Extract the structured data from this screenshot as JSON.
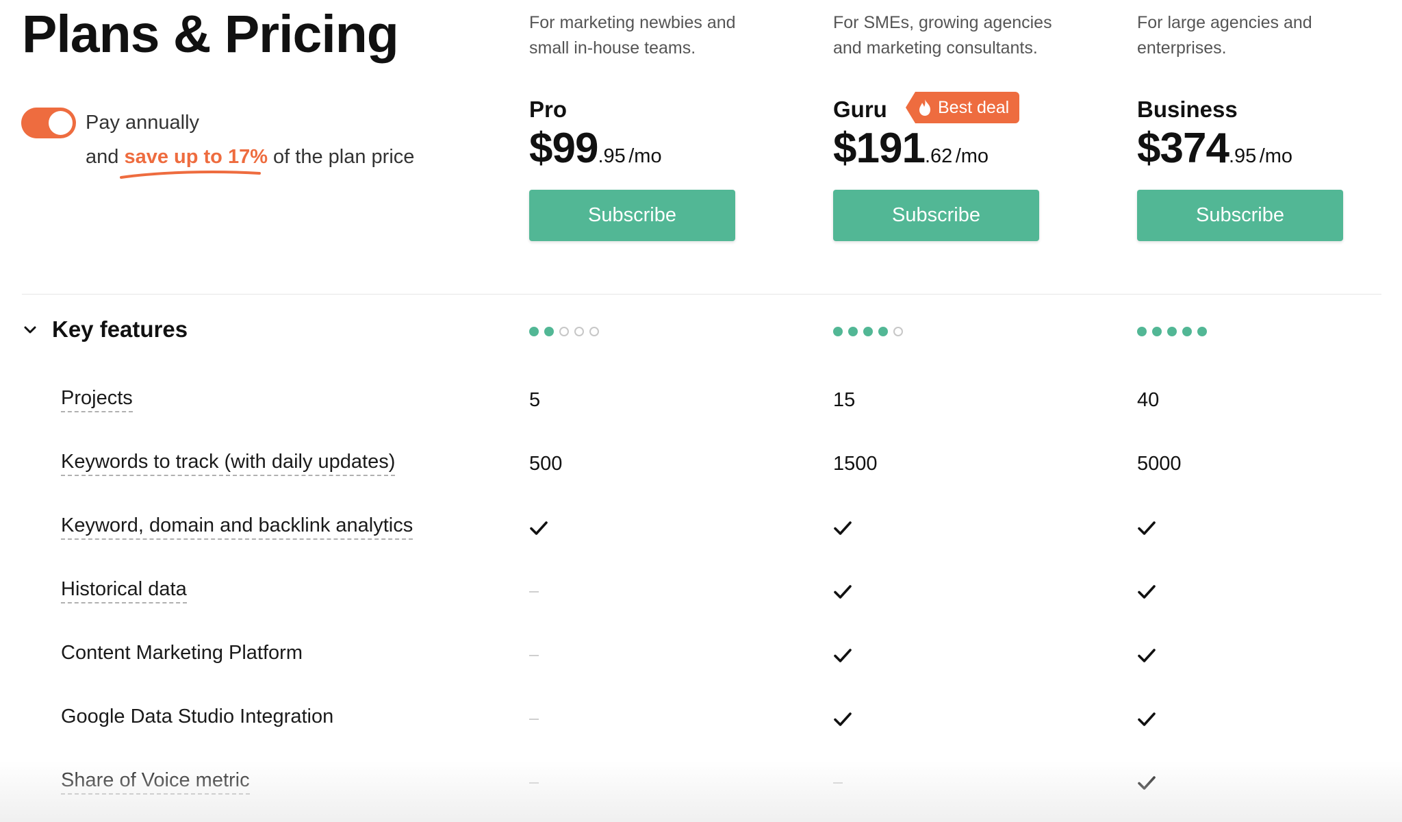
{
  "page": {
    "title": "Plans & Pricing"
  },
  "billing": {
    "toggle_on": true,
    "label": "Pay annually",
    "prefix": "and",
    "save_text": "save up to 17%",
    "suffix": "of the plan price"
  },
  "plans": [
    {
      "description": "For marketing newbies and small in-house teams.",
      "name": "Pro",
      "price_main": "$99",
      "price_cents": ".95",
      "price_unit": "/mo",
      "subscribe_label": "Subscribe",
      "rating": 2,
      "rating_max": 5
    },
    {
      "description": "For SMEs, growing agencies and marketing consultants.",
      "name": "Guru",
      "badge": "Best deal",
      "price_main": "$191",
      "price_cents": ".62",
      "price_unit": "/mo",
      "subscribe_label": "Subscribe",
      "rating": 4,
      "rating_max": 5
    },
    {
      "description": "For large agencies and enterprises.",
      "name": "Business",
      "price_main": "$374",
      "price_cents": ".95",
      "price_unit": "/mo",
      "subscribe_label": "Subscribe",
      "rating": 5,
      "rating_max": 5
    }
  ],
  "section": {
    "title": "Key features",
    "expanded": true
  },
  "features": [
    {
      "label": "Projects",
      "tooltip": true,
      "values": [
        "5",
        "15",
        "40"
      ]
    },
    {
      "label": "Keywords to track (with daily updates)",
      "tooltip": true,
      "values": [
        "500",
        "1500",
        "5000"
      ]
    },
    {
      "label": "Keyword, domain and backlink analytics",
      "tooltip": true,
      "values": [
        "check",
        "check",
        "check"
      ]
    },
    {
      "label": "Historical data",
      "tooltip": true,
      "values": [
        "none",
        "check",
        "check"
      ]
    },
    {
      "label": "Content Marketing Platform",
      "tooltip": false,
      "values": [
        "none",
        "check",
        "check"
      ]
    },
    {
      "label": "Google Data Studio Integration",
      "tooltip": false,
      "values": [
        "none",
        "check",
        "check"
      ]
    },
    {
      "label": "Share of Voice metric",
      "tooltip": true,
      "values": [
        "none",
        "none",
        "check"
      ]
    }
  ],
  "colors": {
    "accent": "#ee6c3f",
    "cta": "#52b795",
    "text": "#181818",
    "muted": "#555555"
  },
  "icons": {
    "check": "check-icon",
    "none": "dash-icon",
    "chevron": "chevron-down-icon",
    "flame": "flame-icon"
  }
}
